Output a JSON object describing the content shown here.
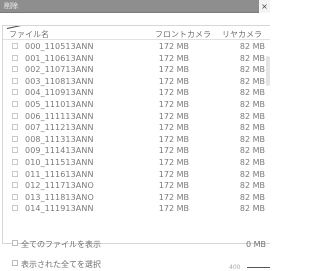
{
  "window": {
    "title": "削除",
    "close_label": "×"
  },
  "table": {
    "columns": {
      "name": "ファイル名",
      "front": "フロントカメラ",
      "rear": "リヤカメラ"
    },
    "rows": [
      {
        "name": "000_110513ANN",
        "front": "172 MB",
        "rear": "82 MB"
      },
      {
        "name": "001_110613ANN",
        "front": "172 MB",
        "rear": "82 MB"
      },
      {
        "name": "002_110713ANN",
        "front": "172 MB",
        "rear": "82 MB"
      },
      {
        "name": "003_110813ANN",
        "front": "172 MB",
        "rear": "82 MB"
      },
      {
        "name": "004_110913ANN",
        "front": "172 MB",
        "rear": "82 MB"
      },
      {
        "name": "005_111013ANN",
        "front": "172 MB",
        "rear": "82 MB"
      },
      {
        "name": "006_111113ANN",
        "front": "172 MB",
        "rear": "82 MB"
      },
      {
        "name": "007_111213ANN",
        "front": "172 MB",
        "rear": "82 MB"
      },
      {
        "name": "008_111313ANN",
        "front": "172 MB",
        "rear": "82 MB"
      },
      {
        "name": "009_111413ANN",
        "front": "172 MB",
        "rear": "82 MB"
      },
      {
        "name": "010_111513ANN",
        "front": "172 MB",
        "rear": "82 MB"
      },
      {
        "name": "011_111613ANN",
        "front": "172 MB",
        "rear": "82 MB"
      },
      {
        "name": "012_111713ANO",
        "front": "172 MB",
        "rear": "82 MB"
      },
      {
        "name": "013_111813ANO",
        "front": "172 MB",
        "rear": "82 MB"
      },
      {
        "name": "014_111913ANN",
        "front": "172 MB",
        "rear": "82 MB"
      }
    ]
  },
  "footer": {
    "show_all_files": "全てのファイルを表示",
    "select_all_shown": "表示された全てを選択",
    "total_size": "0 MB",
    "slider_label": "400"
  },
  "icons": {
    "close": "close-icon"
  }
}
